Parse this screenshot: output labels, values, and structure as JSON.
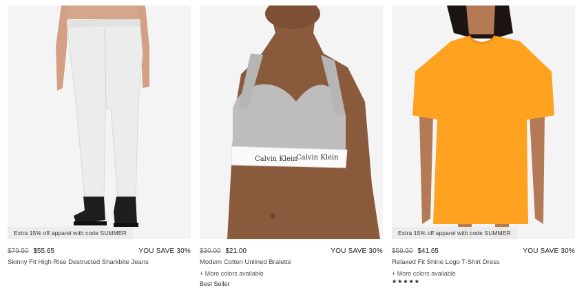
{
  "products": [
    {
      "promo": "Extra 15% off apparel with code SUMMER",
      "old_price": "$79.50",
      "new_price": "$55.65",
      "savings": "YOU SAVE 30%",
      "name": "Skinny Fit High Rise Destructed Sharkbite Jeans",
      "image_icon": "white-jeans-image"
    },
    {
      "old_price": "$30.00",
      "new_price": "$21.00",
      "savings": "YOU SAVE 30%",
      "name": "Modern Cotton Unlined Bralette",
      "more_colors": "+ More colors available",
      "tag": "Best Seller",
      "band_text": "Calvin Klein   Calvin Klein",
      "image_icon": "grey-bralette-image"
    },
    {
      "promo": "Extra 15% off apparel with code SUMMER",
      "old_price": "$59.50",
      "new_price": "$41.65",
      "savings": "YOU SAVE 30%",
      "name": "Relaxed Fit Shine Logo T-Shirt Dress",
      "more_colors": "+ More colors available",
      "rating_stars": "★★★★★",
      "image_icon": "orange-tshirt-dress-image"
    }
  ],
  "colors": {
    "image_bg": "#f3f3f3",
    "orange": "#ffa21f",
    "grey": "#bdbdbd"
  }
}
